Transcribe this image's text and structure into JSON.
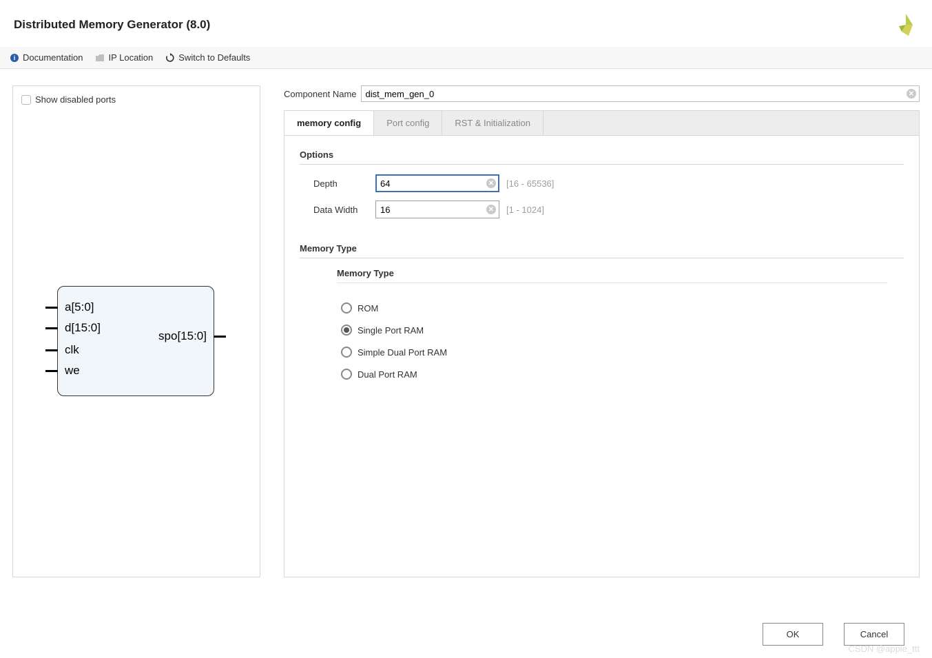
{
  "header": {
    "title": "Distributed Memory Generator (8.0)"
  },
  "toolbar": {
    "documentation": "Documentation",
    "ip_location": "IP Location",
    "switch_defaults": "Switch to Defaults"
  },
  "left": {
    "show_disabled_ports": "Show disabled ports",
    "ports_in": [
      "a[5:0]",
      "d[15:0]",
      "clk",
      "we"
    ],
    "ports_out": [
      "spo[15:0]"
    ]
  },
  "right": {
    "component_name_label": "Component Name",
    "component_name_value": "dist_mem_gen_0",
    "tabs": [
      "memory config",
      "Port config",
      "RST & Initialization"
    ],
    "options": {
      "header": "Options",
      "depth_label": "Depth",
      "depth_value": "64",
      "depth_hint": "[16 - 65536]",
      "width_label": "Data Width",
      "width_value": "16",
      "width_hint": "[1 - 1024]"
    },
    "memtype": {
      "header": "Memory Type",
      "sub_header": "Memory Type",
      "choices": [
        "ROM",
        "Single Port RAM",
        "Simple Dual Port RAM",
        "Dual Port RAM"
      ],
      "selected": "Single Port RAM"
    }
  },
  "footer": {
    "ok": "OK",
    "cancel": "Cancel"
  },
  "watermark": "CSDN @apple_ttt"
}
